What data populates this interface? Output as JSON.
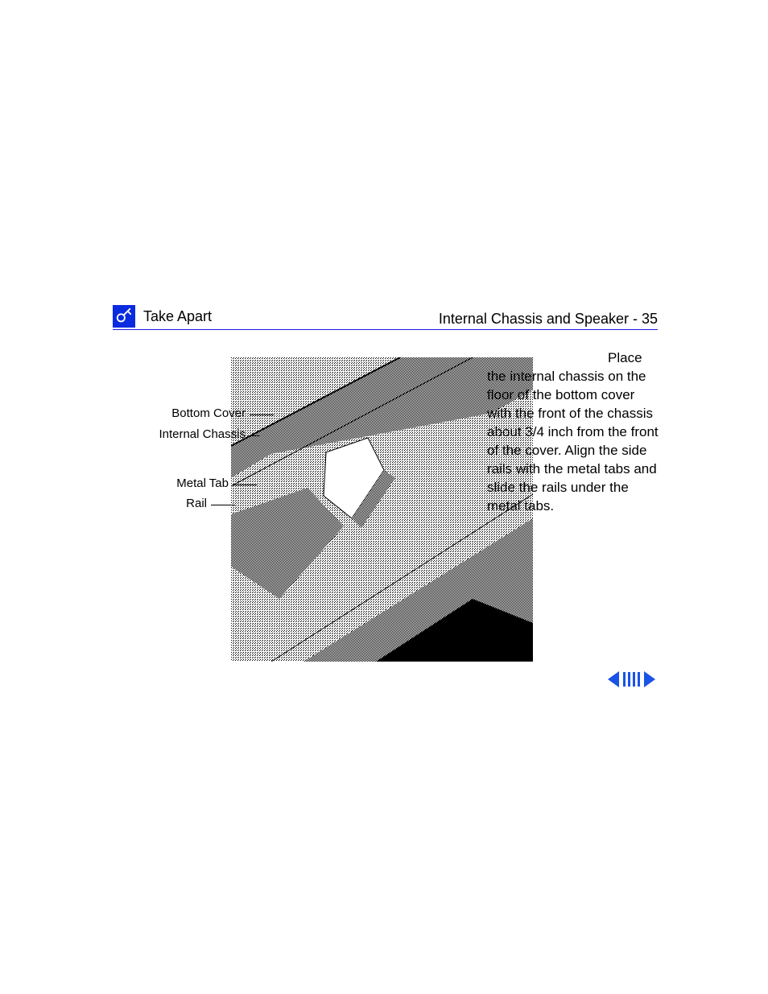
{
  "header": {
    "section": "Take Apart",
    "breadcrumb": "Internal Chassis and Speaker - 35"
  },
  "figure": {
    "callouts": [
      {
        "id": "bottom-cover",
        "label": "Bottom Cover"
      },
      {
        "id": "internal-chassis",
        "label": "Internal Chassis"
      },
      {
        "id": "metal-tab",
        "label": "Metal Tab"
      },
      {
        "id": "rail",
        "label": "Rail"
      }
    ]
  },
  "body": {
    "lead": "Place",
    "paragraph": "the internal chassis on the floor of the bottom cover with the front of the chassis about 3/4 inch from the front of the cover.  Align the side rails with the metal tabs and slide the rails under the metal tabs."
  },
  "nav": {
    "prev": "Previous page",
    "index": "Index",
    "next": "Next page"
  }
}
